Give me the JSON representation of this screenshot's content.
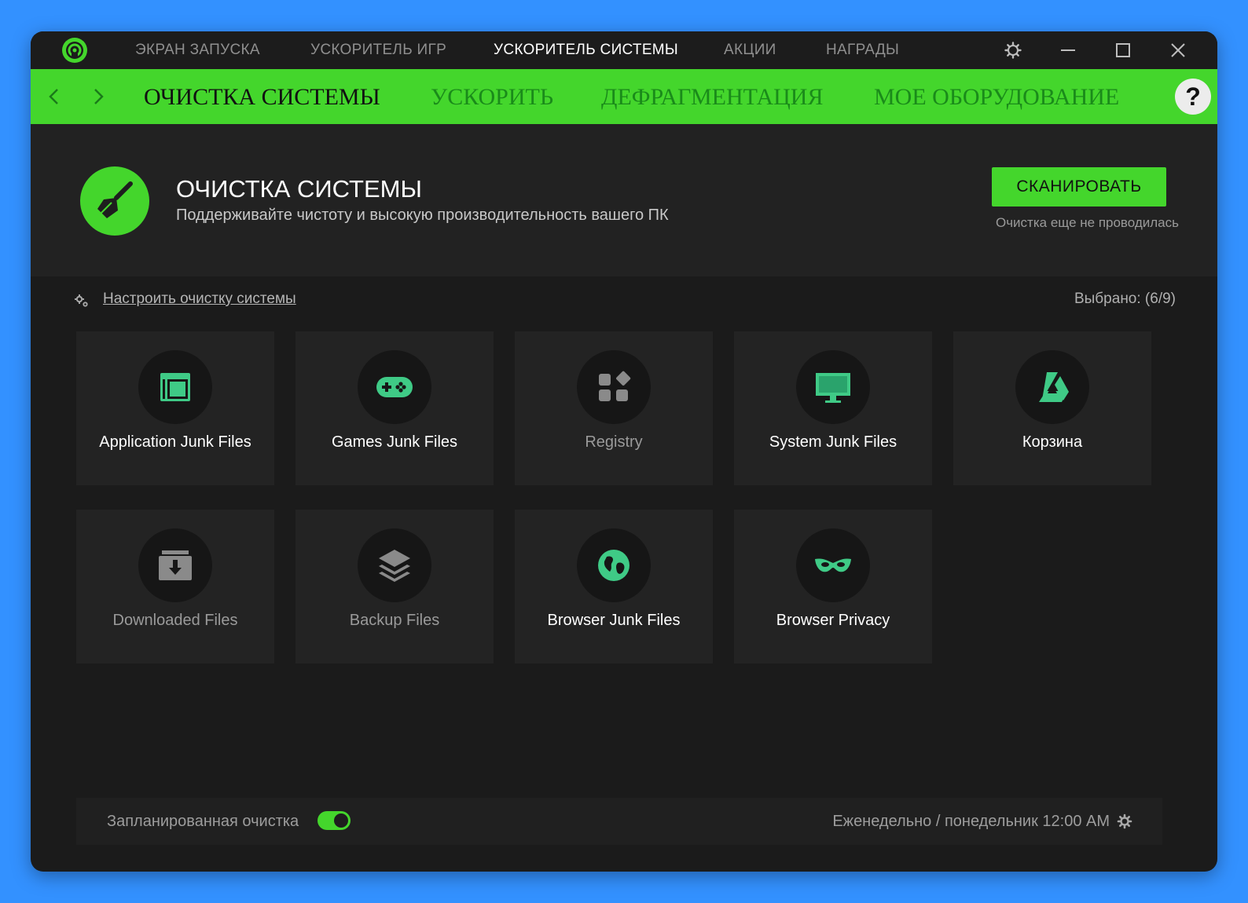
{
  "colors": {
    "accent": "#44d62c",
    "window_bg": "#1b1b1b",
    "desktop_bg": "#3391ff"
  },
  "titlebar": {
    "tabs": [
      {
        "label": "ЭКРАН ЗАПУСКА",
        "active": false
      },
      {
        "label": "УСКОРИТЕЛЬ ИГР",
        "active": false
      },
      {
        "label": "УСКОРИТЕЛЬ СИСТЕМЫ",
        "active": true
      },
      {
        "label": "АКЦИИ",
        "active": false
      },
      {
        "label": "НАГРАДЫ",
        "active": false
      }
    ],
    "icons": [
      "gear-icon",
      "minimize-icon",
      "maximize-icon",
      "close-icon"
    ]
  },
  "subnav": {
    "tabs": [
      {
        "label": "ОЧИСТКА СИСТЕМЫ",
        "active": true
      },
      {
        "label": "УСКОРИТЬ",
        "active": false
      },
      {
        "label": "ДЕФРАГМЕНТАЦИЯ",
        "active": false
      },
      {
        "label": "МОЕ ОБОРУДОВАНИЕ",
        "active": false
      }
    ],
    "help_label": "?"
  },
  "header": {
    "title": "ОЧИСТКА СИСТЕМЫ",
    "subtitle": "Поддерживайте чистоту и высокую производительность вашего ПК",
    "scan_button": "СКАНИРОВАТЬ",
    "scan_status": "Очистка еще не проводилась"
  },
  "settings": {
    "link": "Настроить очистку системы",
    "selected": "Выбрано: (6/9)"
  },
  "tiles": [
    {
      "label": "Application Junk Files",
      "icon": "app-panel-icon",
      "selected": true
    },
    {
      "label": "Games Junk Files",
      "icon": "gamepad-icon",
      "selected": true
    },
    {
      "label": "Registry",
      "icon": "registry-blocks-icon",
      "selected": false
    },
    {
      "label": "System Junk Files",
      "icon": "monitor-icon",
      "selected": true
    },
    {
      "label": "Корзина",
      "icon": "recycle-triangle-icon",
      "selected": true
    },
    {
      "label": "Downloaded Files",
      "icon": "download-folder-icon",
      "selected": false
    },
    {
      "label": "Backup Files",
      "icon": "layers-icon",
      "selected": false
    },
    {
      "label": "Browser Junk Files",
      "icon": "globe-icon",
      "selected": true
    },
    {
      "label": "Browser Privacy",
      "icon": "mask-icon",
      "selected": true
    }
  ],
  "schedule": {
    "label": "Запланированная очистка",
    "enabled": true,
    "value": "Еженедельно / понедельник 12:00 AM"
  }
}
